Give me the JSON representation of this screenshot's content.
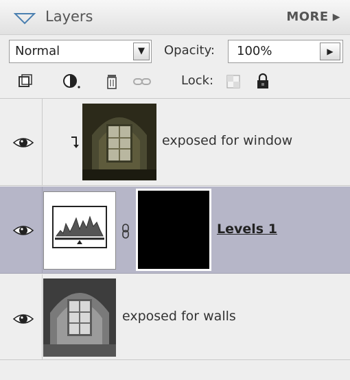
{
  "panel": {
    "title": "Layers",
    "more_label": "MORE"
  },
  "toolbar": {
    "blend_mode": "Normal",
    "opacity_label": "Opacity:",
    "opacity_value": "100%",
    "lock_label": "Lock:"
  },
  "layers": [
    {
      "name": "exposed for window",
      "visible": true,
      "clipped": true,
      "selected": false
    },
    {
      "name": "Levels 1",
      "visible": true,
      "adjustment": true,
      "selected": true
    },
    {
      "name": "exposed for walls",
      "visible": true,
      "selected": false
    }
  ],
  "colors": {
    "selected_row": "#b6b6c8",
    "panel_bg": "#eeeeee"
  },
  "icons": [
    "collapse-triangle-icon",
    "more-arrow-icon",
    "dropdown-arrow-icon",
    "stepper-arrow-icon",
    "new-layer-icon",
    "adjustment-layer-icon",
    "trash-icon",
    "link-icon",
    "lock-transparency-icon",
    "lock-icon",
    "eye-icon",
    "clip-arrow-icon",
    "chain-link-icon"
  ]
}
